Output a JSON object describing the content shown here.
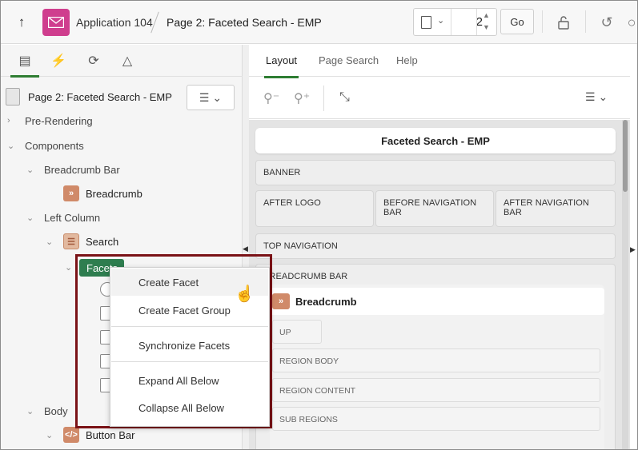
{
  "header": {
    "app_name": "Application 104",
    "page_name": "Page 2: Faceted Search - EMP",
    "page_number": "2",
    "go_label": "Go"
  },
  "left": {
    "tree_title": "Page 2: Faceted Search - EMP",
    "nodes": {
      "pre_rendering": "Pre-Rendering",
      "components": "Components",
      "breadcrumb_bar": "Breadcrumb Bar",
      "breadcrumb": "Breadcrumb",
      "left_column": "Left Column",
      "search": "Search",
      "facets": "Facets",
      "body": "Body",
      "button_bar": "Button Bar"
    }
  },
  "right": {
    "tabs": [
      "Layout",
      "Page Search",
      "Help"
    ],
    "page_title": "Faceted Search - EMP",
    "positions": {
      "banner": "BANNER",
      "after_logo": "AFTER LOGO",
      "before_nav": "BEFORE NAVIGATION BAR",
      "after_nav": "AFTER NAVIGATION BAR",
      "top_nav": "TOP NAVIGATION",
      "breadcrumb_bar": "BREADCRUMB BAR"
    },
    "region": {
      "name": "Breadcrumb",
      "up": "UP",
      "region_body": "REGION BODY",
      "region_content": "REGION CONTENT",
      "sub_regions": "SUB REGIONS"
    }
  },
  "context_menu": {
    "items": [
      "Create Facet",
      "Create Facet Group",
      "Synchronize Facets",
      "Expand All Below",
      "Collapse All Below"
    ]
  }
}
